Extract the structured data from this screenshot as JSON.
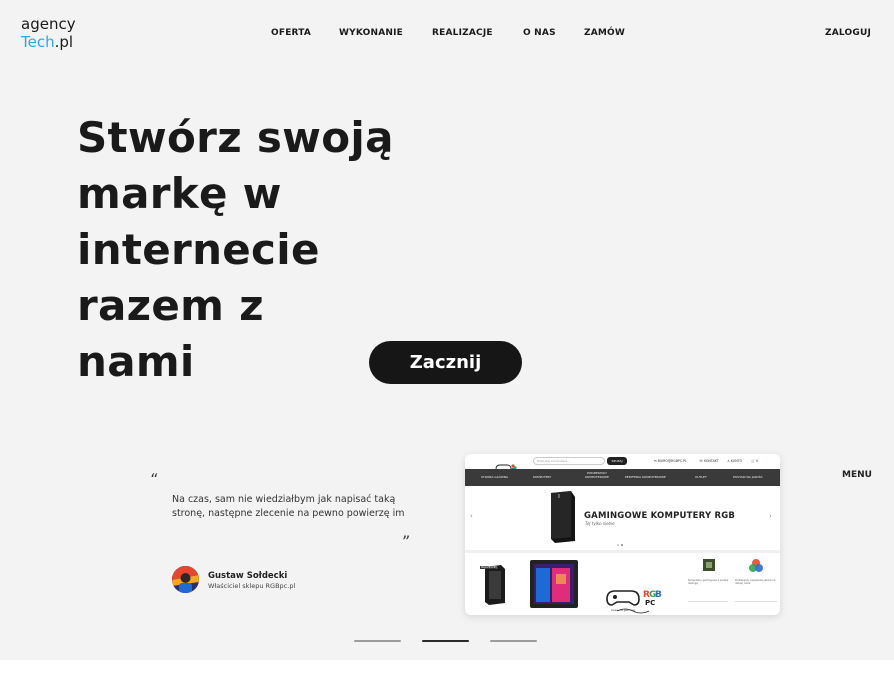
{
  "header": {
    "logo": {
      "line1": "agency",
      "tech": "Tech",
      "pl": ".pl"
    },
    "nav": [
      "OFERTA",
      "WYKONANIE",
      "REALIZACJE",
      "O NAS",
      "ZAMÓW"
    ],
    "login": "ZALOGUJ"
  },
  "hero": {
    "title_lines": [
      "Stwórz swoją",
      "markę w",
      "internecie",
      "razem z",
      "nami"
    ],
    "cta": "Zacznij"
  },
  "testimonial": {
    "open_quote": "“",
    "text": "Na czas, sam nie wiedziałbym jak napisać taką stronę, następne zlecenie na pewno powierzę im",
    "close_quote": "”",
    "author_name": "Gustaw Sołdecki",
    "author_role": "Właściciel sklepu RGBpc.pl"
  },
  "menu_label": "MENU",
  "preview": {
    "search_placeholder": "Poszukaj komputera...",
    "search_button": "SZUKAJ",
    "top_links": [
      "✉ BIURO@RGBPC.PL",
      "☏ KONTAKT",
      "♙ KONTO",
      "🛒 0"
    ],
    "nav": [
      "STRONA GŁÓWNA",
      "KOMPUTERY",
      "PODZESPOŁY KOMPUTEROWE",
      "PERYFERIA KOMPUTEROWE",
      "OUTLET",
      "POSTAW NA JAKOŚĆ"
    ],
    "banner_title": "GAMINGOWE KOMPUTERY RGB",
    "banner_sub": "Tej tylko siebie",
    "badge": "NAJCZĘŚCIEJ",
    "side_text_1": "Komputery gamingowe z polską obsługą",
    "side_text_2": "Podzespoły najwyższej jakości w dobrej cenie",
    "brand_script": "Czas na gaming"
  },
  "slider": {
    "count": 3,
    "active": 1
  },
  "colors": {
    "accent": "#2fa8e0",
    "dark": "#161616",
    "background": "#f3f3f3"
  }
}
